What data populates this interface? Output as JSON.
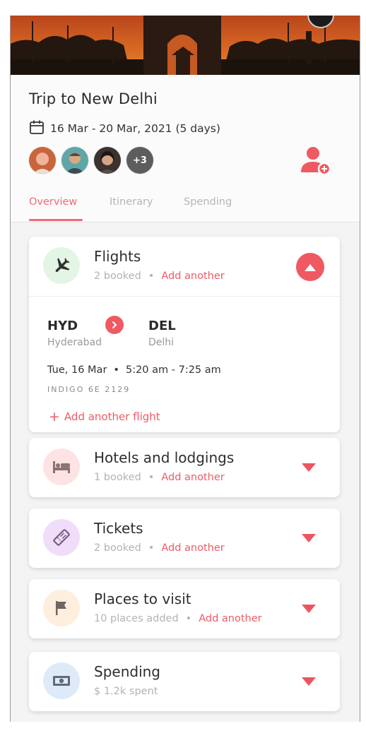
{
  "trip": {
    "title": "Trip to New Delhi",
    "dates": "16 Mar - 20 Mar, 2021 (5 days)",
    "extra_members": "+3"
  },
  "tabs": [
    {
      "label": "Overview",
      "active": true
    },
    {
      "label": "Itinerary",
      "active": false
    },
    {
      "label": "Spending",
      "active": false
    }
  ],
  "categories": {
    "flights": {
      "title": "Flights",
      "count": "2 booked",
      "add": "Add another",
      "icon": "airplane-icon",
      "expanded": true
    },
    "hotels": {
      "title": "Hotels and lodgings",
      "count": "1 booked",
      "add": "Add another",
      "icon": "bed-icon"
    },
    "tickets": {
      "title": "Tickets",
      "count": "2 booked",
      "add": "Add another",
      "icon": "ticket-icon"
    },
    "places": {
      "title": "Places to visit",
      "count": "10 places added",
      "add": "Add another",
      "icon": "flag-icon"
    },
    "spending": {
      "title": "Spending",
      "count": "$ 1.2k spent",
      "icon": "money-icon"
    }
  },
  "flight": {
    "from_code": "HYD",
    "from_city": "Hyderabad",
    "to_code": "DEL",
    "to_city": "Delhi",
    "date": "Tue, 16 Mar",
    "time": "5:20 am - 7:25 am",
    "flight_number": "INDIGO 6E 2129",
    "add_flight": "Add another flight"
  },
  "colors": {
    "accent": "#ef5a62",
    "flights_bg": "#e3f5e4",
    "hotels_bg": "#fde3e4",
    "tickets_bg": "#f0ddf9",
    "places_bg": "#fdeede",
    "spending_bg": "#dfeaf9"
  }
}
